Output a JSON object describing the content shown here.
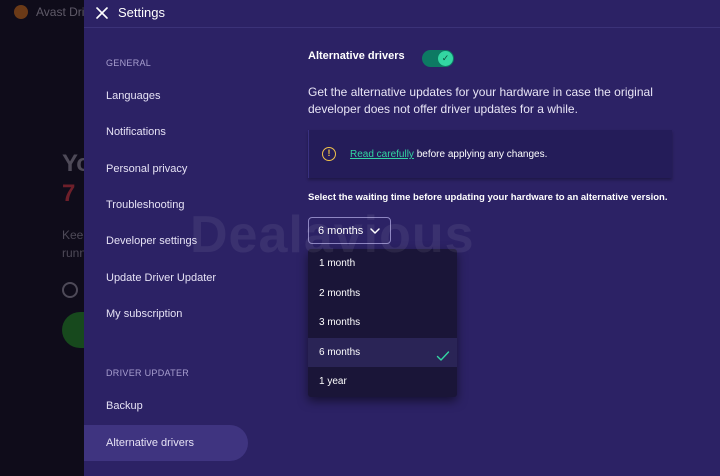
{
  "background_app": {
    "title": "Avast Dri",
    "big_line1": "Yo",
    "big_line2": "7",
    "small_line1": "Kee",
    "small_line2": "runn"
  },
  "settings": {
    "title": "Settings",
    "close_icon": "close-icon"
  },
  "sidebar": {
    "general_label": "GENERAL",
    "general_items": [
      {
        "label": "Languages"
      },
      {
        "label": "Notifications"
      },
      {
        "label": "Personal privacy"
      },
      {
        "label": "Troubleshooting"
      },
      {
        "label": "Developer settings"
      },
      {
        "label": "Update Driver Updater"
      },
      {
        "label": "My subscription"
      }
    ],
    "driver_label": "DRIVER UPDATER",
    "driver_items": [
      {
        "label": "Backup",
        "active": false
      },
      {
        "label": "Alternative drivers",
        "active": true
      }
    ]
  },
  "content": {
    "title": "Alternative drivers",
    "toggle_on": true,
    "description": "Get the alternative updates for your hardware in case the original developer does not offer driver updates for a while.",
    "alert": {
      "icon": "exclamation-circle-icon",
      "link_text": "Read carefully",
      "text": " before applying any changes."
    },
    "wait_label": "Select the waiting time before updating your hardware to an alternative version.",
    "select": {
      "value": "6 months",
      "options": [
        {
          "label": "1 month"
        },
        {
          "label": "2 months"
        },
        {
          "label": "3 months"
        },
        {
          "label": "6 months",
          "selected": true
        },
        {
          "label": "1 year"
        }
      ]
    }
  },
  "watermark": "Dealavious",
  "colors": {
    "panel_bg": "#2c2265",
    "accent": "#33d6a2",
    "warning": "#f0c24b"
  }
}
